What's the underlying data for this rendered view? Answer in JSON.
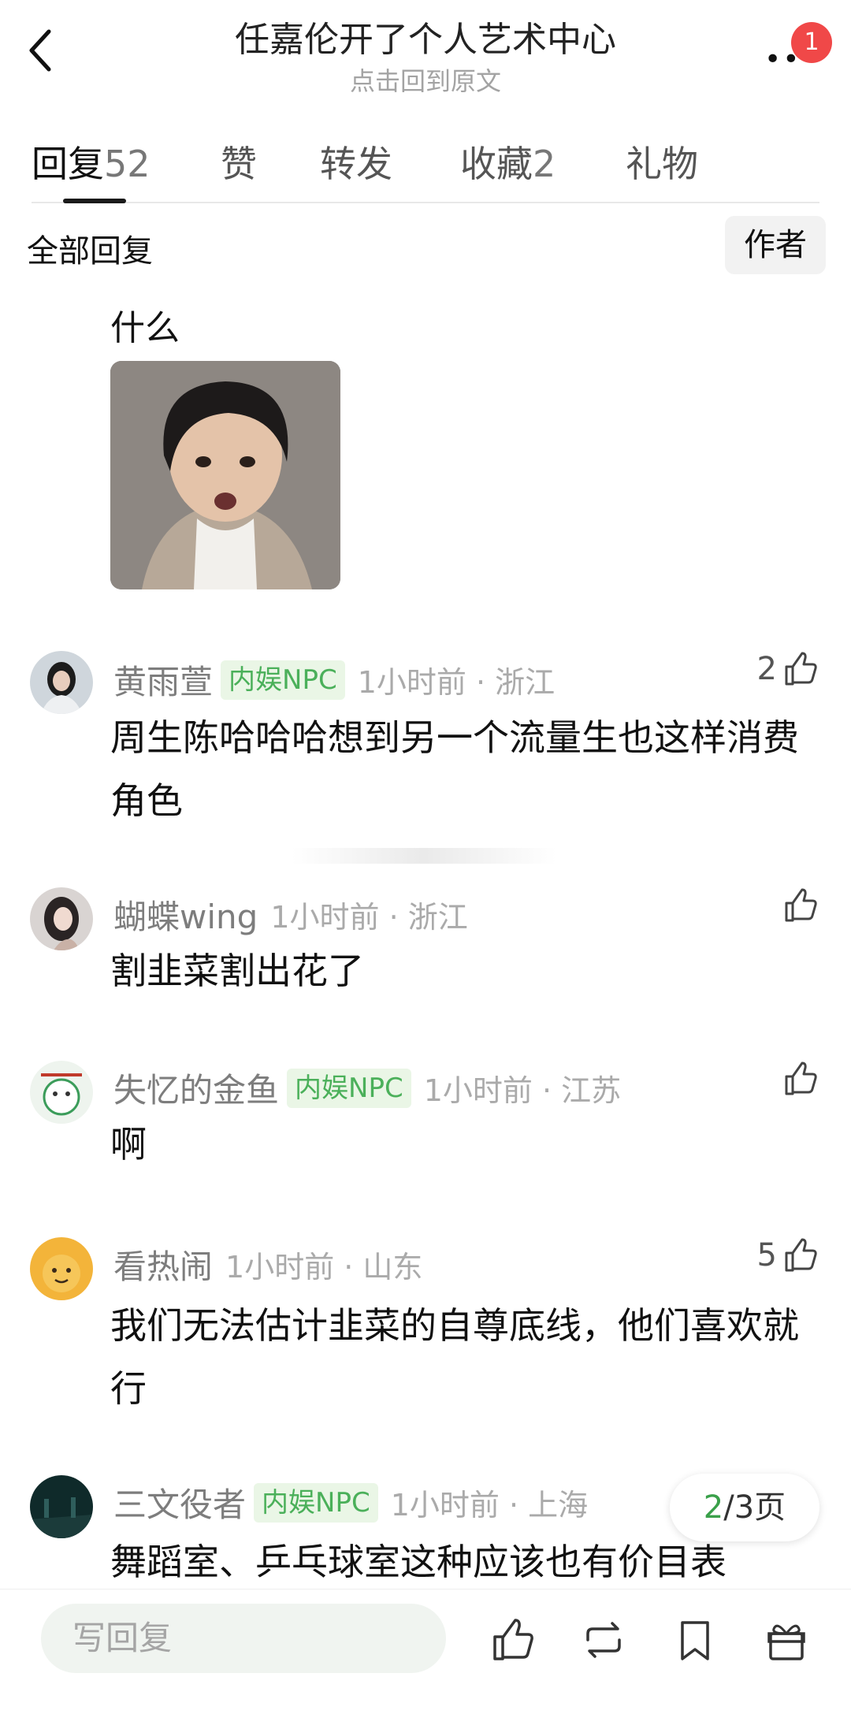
{
  "header": {
    "title": "任嘉伦开了个人艺术中心",
    "subtitle": "点击回到原文",
    "more_badge": "1"
  },
  "tabs": [
    {
      "label": "回复",
      "count": "52",
      "active": true
    },
    {
      "label": "赞",
      "count": ""
    },
    {
      "label": "转发",
      "count": ""
    },
    {
      "label": "收藏",
      "count": "2"
    },
    {
      "label": "礼物",
      "count": ""
    }
  ],
  "filter": {
    "all_label": "全部回复",
    "author_label": "作者"
  },
  "quote": {
    "text": "什么"
  },
  "comments": [
    {
      "user": "黄雨萱",
      "tag": "内娱NPC",
      "time": "1小时前 · 浙江",
      "likes": "2",
      "text": "周生陈哈哈哈想到另一个流量生也这样消费角色"
    },
    {
      "user": "蝴蝶wing",
      "tag": "",
      "time": "1小时前 · 浙江",
      "likes": "",
      "text": "割韭菜割出花了"
    },
    {
      "user": "失忆的金鱼",
      "tag": "内娱NPC",
      "time": "1小时前 · 江苏",
      "likes": "",
      "text": "啊"
    },
    {
      "user": "看热闹",
      "tag": "",
      "time": "1小时前 · 山东",
      "likes": "5",
      "text": "我们无法估计韭菜的自尊底线，他们喜欢就行"
    },
    {
      "user": "三文役者",
      "tag": "内娱NPC",
      "time": "1小时前 · 上海",
      "likes": "",
      "text": "舞蹈室、乒乓球室这种应该也有价目表"
    }
  ],
  "pager": {
    "current": "2",
    "total": "/3页"
  },
  "bottom_bar": {
    "reply_placeholder": "写回复",
    "icons": [
      "thumbs-up-icon",
      "repost-icon",
      "bookmark-icon",
      "gift-icon"
    ]
  },
  "colors": {
    "tag_bg": "#eaf6e6",
    "tag_text": "#4bb05a",
    "badge": "#f04848",
    "pager_current": "#3aa04a"
  }
}
